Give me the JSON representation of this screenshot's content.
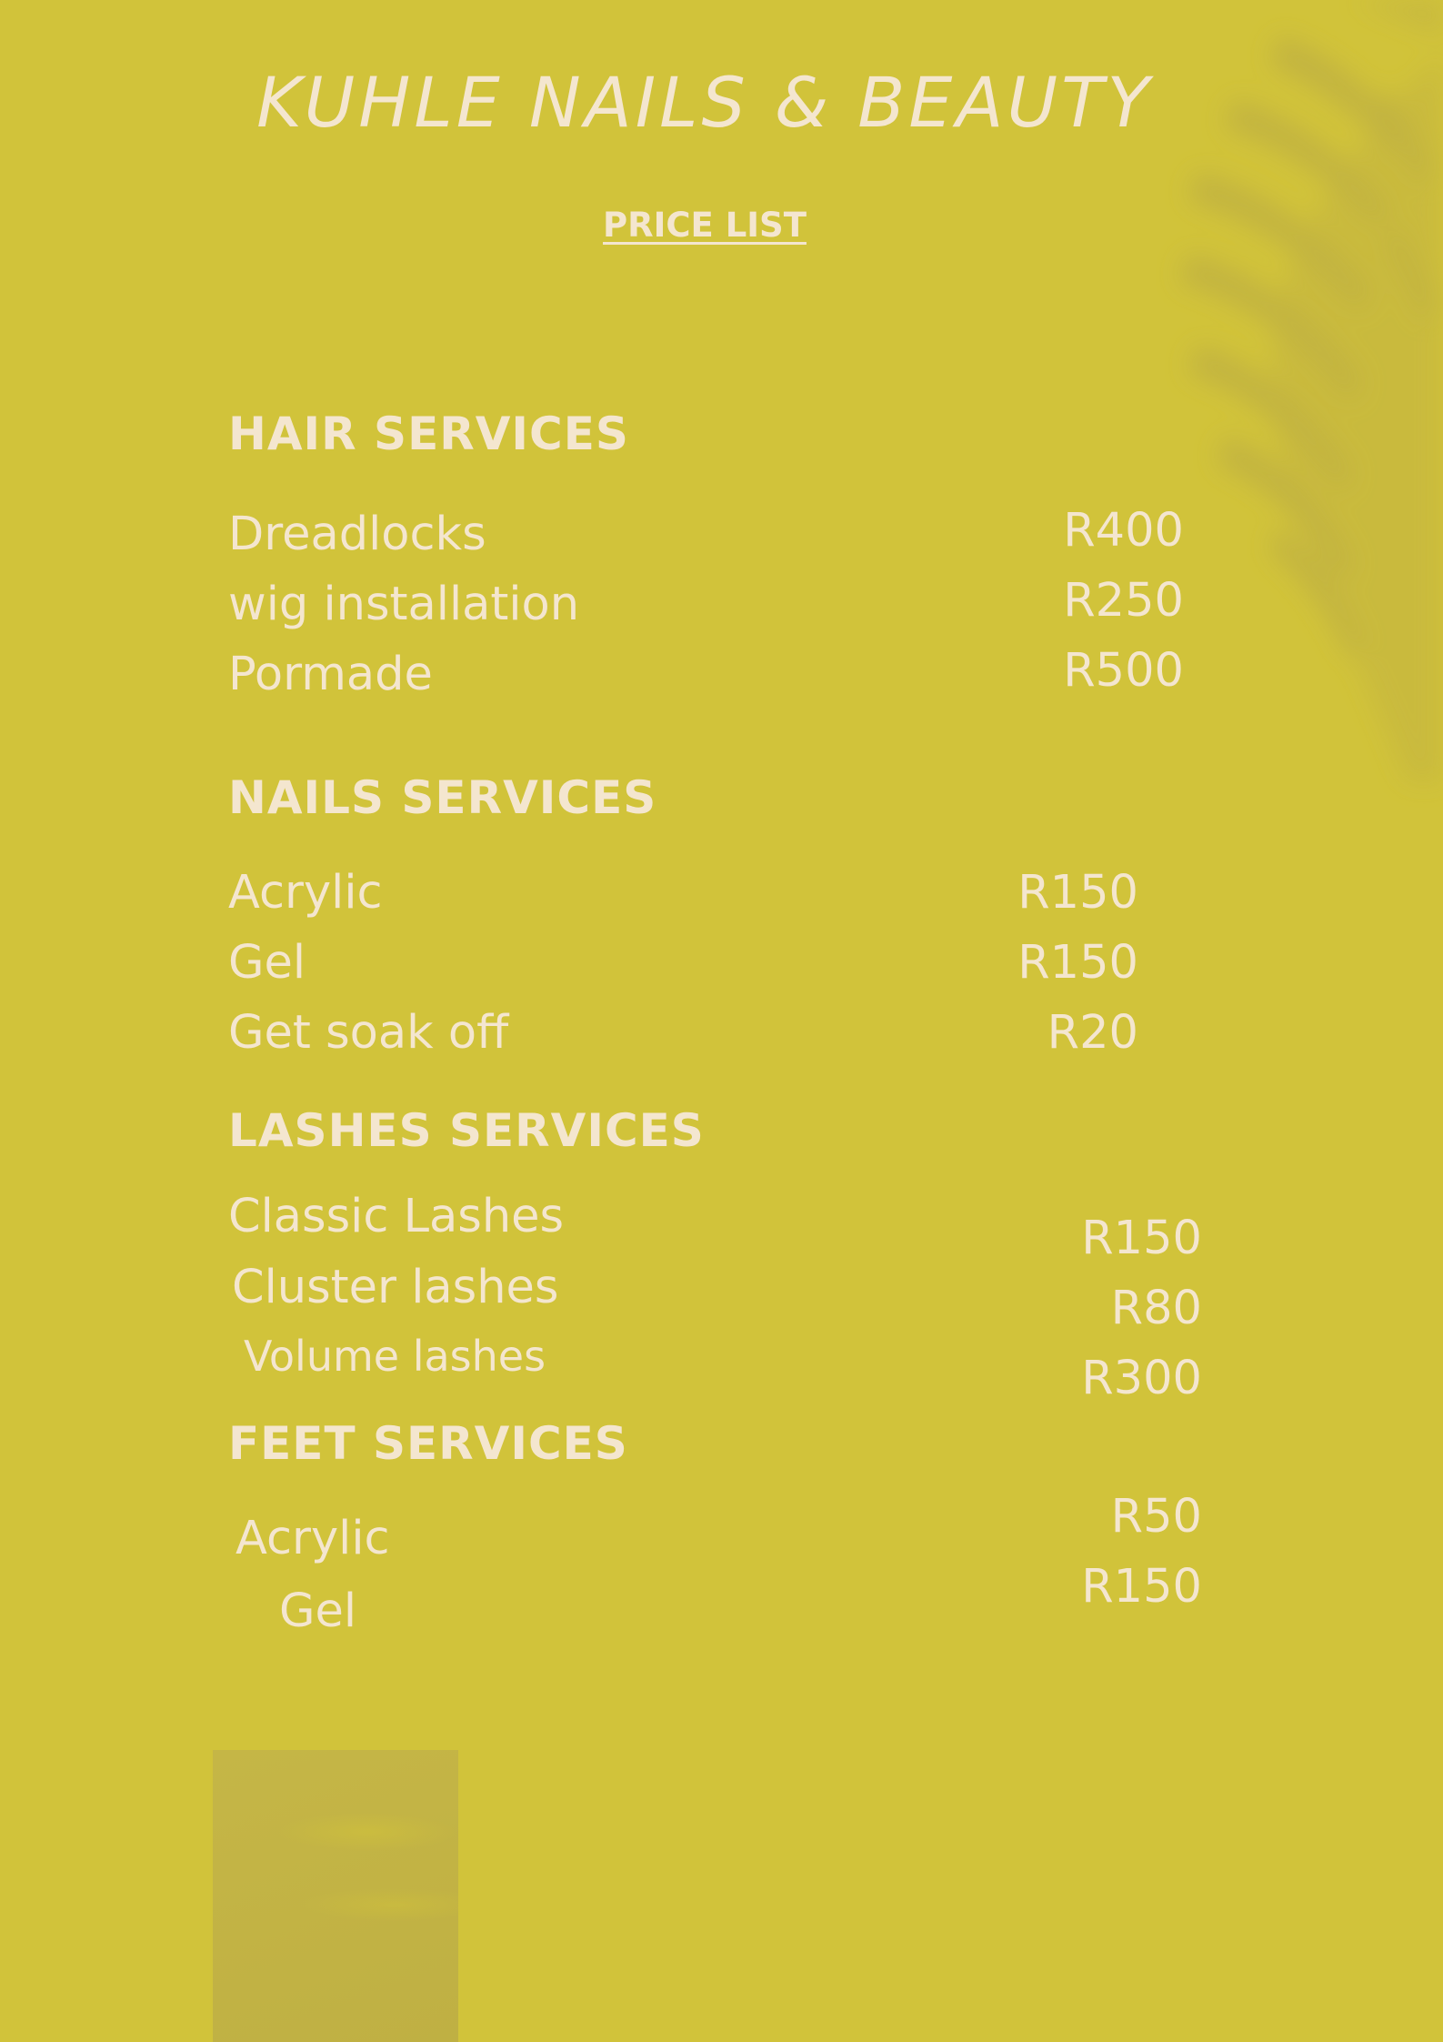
{
  "title": "KUHLE NAILS & BEAUTY",
  "subtitle": "PRICE LIST",
  "sections": [
    {
      "heading": "HAIR SERVICES",
      "items": [
        {
          "name": "Dreadlocks",
          "price": "R400"
        },
        {
          "name": "wig installation",
          "price": "R250"
        },
        {
          "name": "Pormade",
          "price": "R500"
        }
      ]
    },
    {
      "heading": "NAILS SERVICES",
      "items": [
        {
          "name": "Acrylic",
          "price": "R150"
        },
        {
          "name": "Gel",
          "price": "R150"
        },
        {
          "name": "Get soak off",
          "price": "R20"
        }
      ]
    },
    {
      "heading": "LASHES SERVICES",
      "items": [
        {
          "name": "Classic Lashes",
          "price": "R150"
        },
        {
          "name": "Cluster lashes",
          "price": "R80"
        },
        {
          "name": "Volume lashes",
          "price": "R300"
        }
      ]
    },
    {
      "heading": "FEET SERVICES",
      "items": [
        {
          "name": "Acrylic",
          "price": "R50"
        },
        {
          "name": "Gel",
          "price": "R150"
        }
      ]
    }
  ],
  "colors": {
    "background": "#d1c33a",
    "text": "#f4e6cf",
    "shadow": "#bfb043"
  }
}
